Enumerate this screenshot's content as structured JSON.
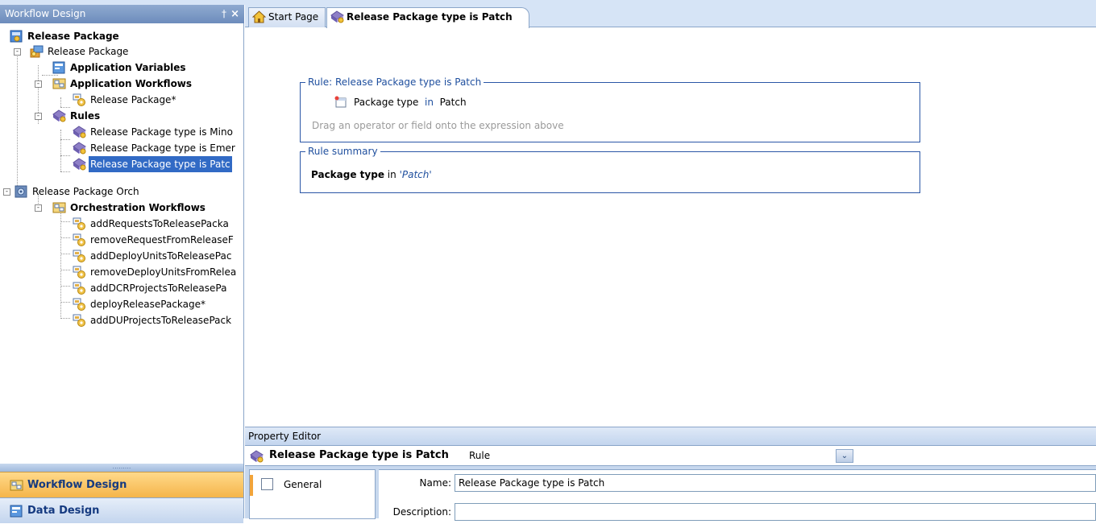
{
  "left_panel": {
    "title": "Workflow Design",
    "pin_glyph": "†",
    "close_glyph": "×",
    "tree": {
      "root": "Release Package",
      "app": "Release Package",
      "app_vars": "Application Variables",
      "app_workflows": "Application Workflows",
      "workflow_item": "Release Package*",
      "rules": "Rules",
      "rule_items": [
        "Release Package type is Mino",
        "Release Package type is Emer",
        "Release Package type is Patc"
      ],
      "orch": "Release Package Orch",
      "orch_workflows": "Orchestration Workflows",
      "orch_items": [
        "addRequestsToReleasePacka",
        "removeRequestFromReleaseF",
        "addDeployUnitsToReleasePac",
        "removeDeployUnitsFromRelea",
        "addDCRProjectsToReleasePa",
        "deployReleasePackage*",
        "addDUProjectsToReleasePack"
      ]
    },
    "grip": ".........",
    "nav": {
      "workflow_design": "Workflow Design",
      "data_design": "Data Design"
    }
  },
  "tabs": {
    "start_page": "Start Page",
    "rule_tab": "Release Package type is Patch"
  },
  "rule_box": {
    "legend": "Rule: Release Package type is Patch",
    "field": "Package type",
    "operator": "in",
    "value": "Patch",
    "hint": "Drag an operator or field onto the expression above"
  },
  "summary_box": {
    "legend": "Rule summary",
    "field": "Package type",
    "operator": "in",
    "value": "'Patch'"
  },
  "property_editor": {
    "title": "Property Editor",
    "name": "Release Package type is Patch",
    "type": "Rule",
    "dropdown_glyph": "⌄",
    "side_item": "General",
    "name_label": "Name:",
    "name_value": "Release Package type is Patch",
    "description_label": "Description:",
    "description_value": ""
  },
  "colors": {
    "accent": "#316ac5",
    "panel_header": "#6d8cbc",
    "nav_active": "#f5b54a",
    "legend_text": "#1f4f9e"
  },
  "icons": [
    "home-icon",
    "rule-icon",
    "package-icon",
    "variables-icon",
    "workflow-icon",
    "orchestration-icon",
    "field-icon",
    "general-icon"
  ]
}
